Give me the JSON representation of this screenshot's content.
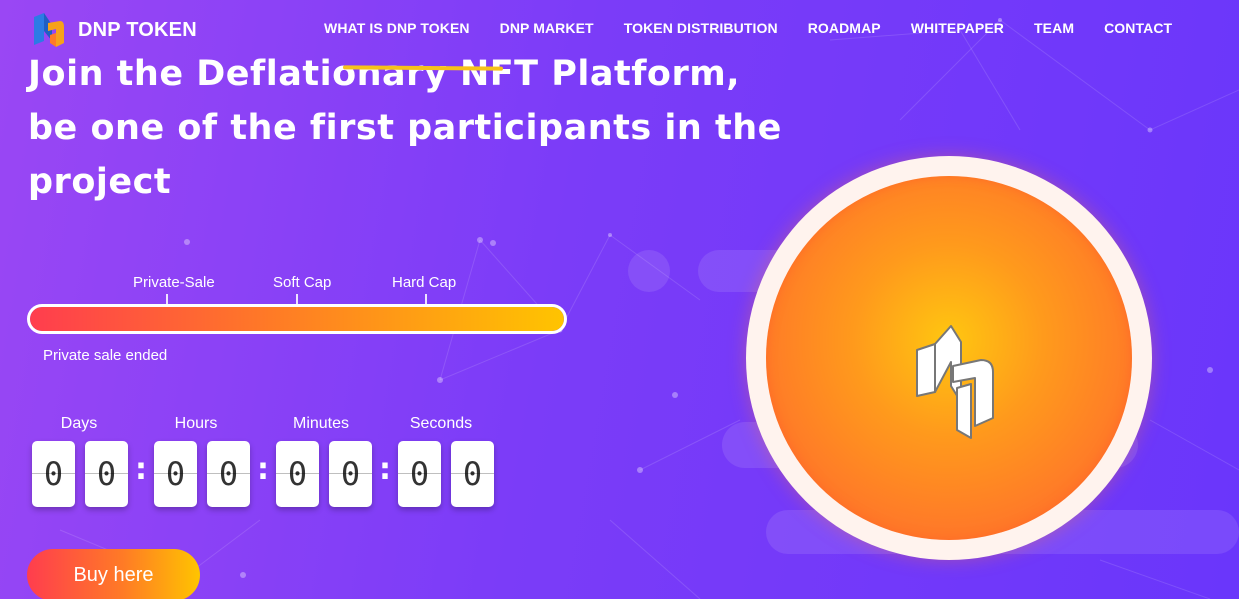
{
  "brand": {
    "name": "DNP TOKEN",
    "logo_icon": "dnp-logo-icon"
  },
  "nav": {
    "items": [
      {
        "label": "WHAT IS DNP TOKEN"
      },
      {
        "label": "DNP MARKET"
      },
      {
        "label": "TOKEN DISTRIBUTION"
      },
      {
        "label": "ROADMAP"
      },
      {
        "label": "WHITEPAPER"
      },
      {
        "label": "TEAM"
      },
      {
        "label": "CONTACT"
      }
    ]
  },
  "hero": {
    "lines": [
      "Join the Deflationary NFT Platform,",
      "be one of the first participants in the",
      "project"
    ]
  },
  "progress": {
    "milestones": [
      "Private-Sale",
      "Soft Cap",
      "Hard Cap"
    ],
    "fill_percent": 100,
    "status": "Private sale ended"
  },
  "countdown": {
    "labels": {
      "days": "Days",
      "hours": "Hours",
      "minutes": "Minutes",
      "seconds": "Seconds"
    },
    "digits": {
      "days": [
        "0",
        "0"
      ],
      "hours": [
        "0",
        "0"
      ],
      "minutes": [
        "0",
        "0"
      ],
      "seconds": [
        "0",
        "0"
      ]
    },
    "separator": ":"
  },
  "cta": {
    "label": "Buy here"
  },
  "colors": {
    "background_start": "#9a47f4",
    "background_end": "#6a36fb",
    "accent_orange": "#ff7a28",
    "accent_yellow": "#ffc400",
    "accent_red": "#ff3d4e"
  }
}
